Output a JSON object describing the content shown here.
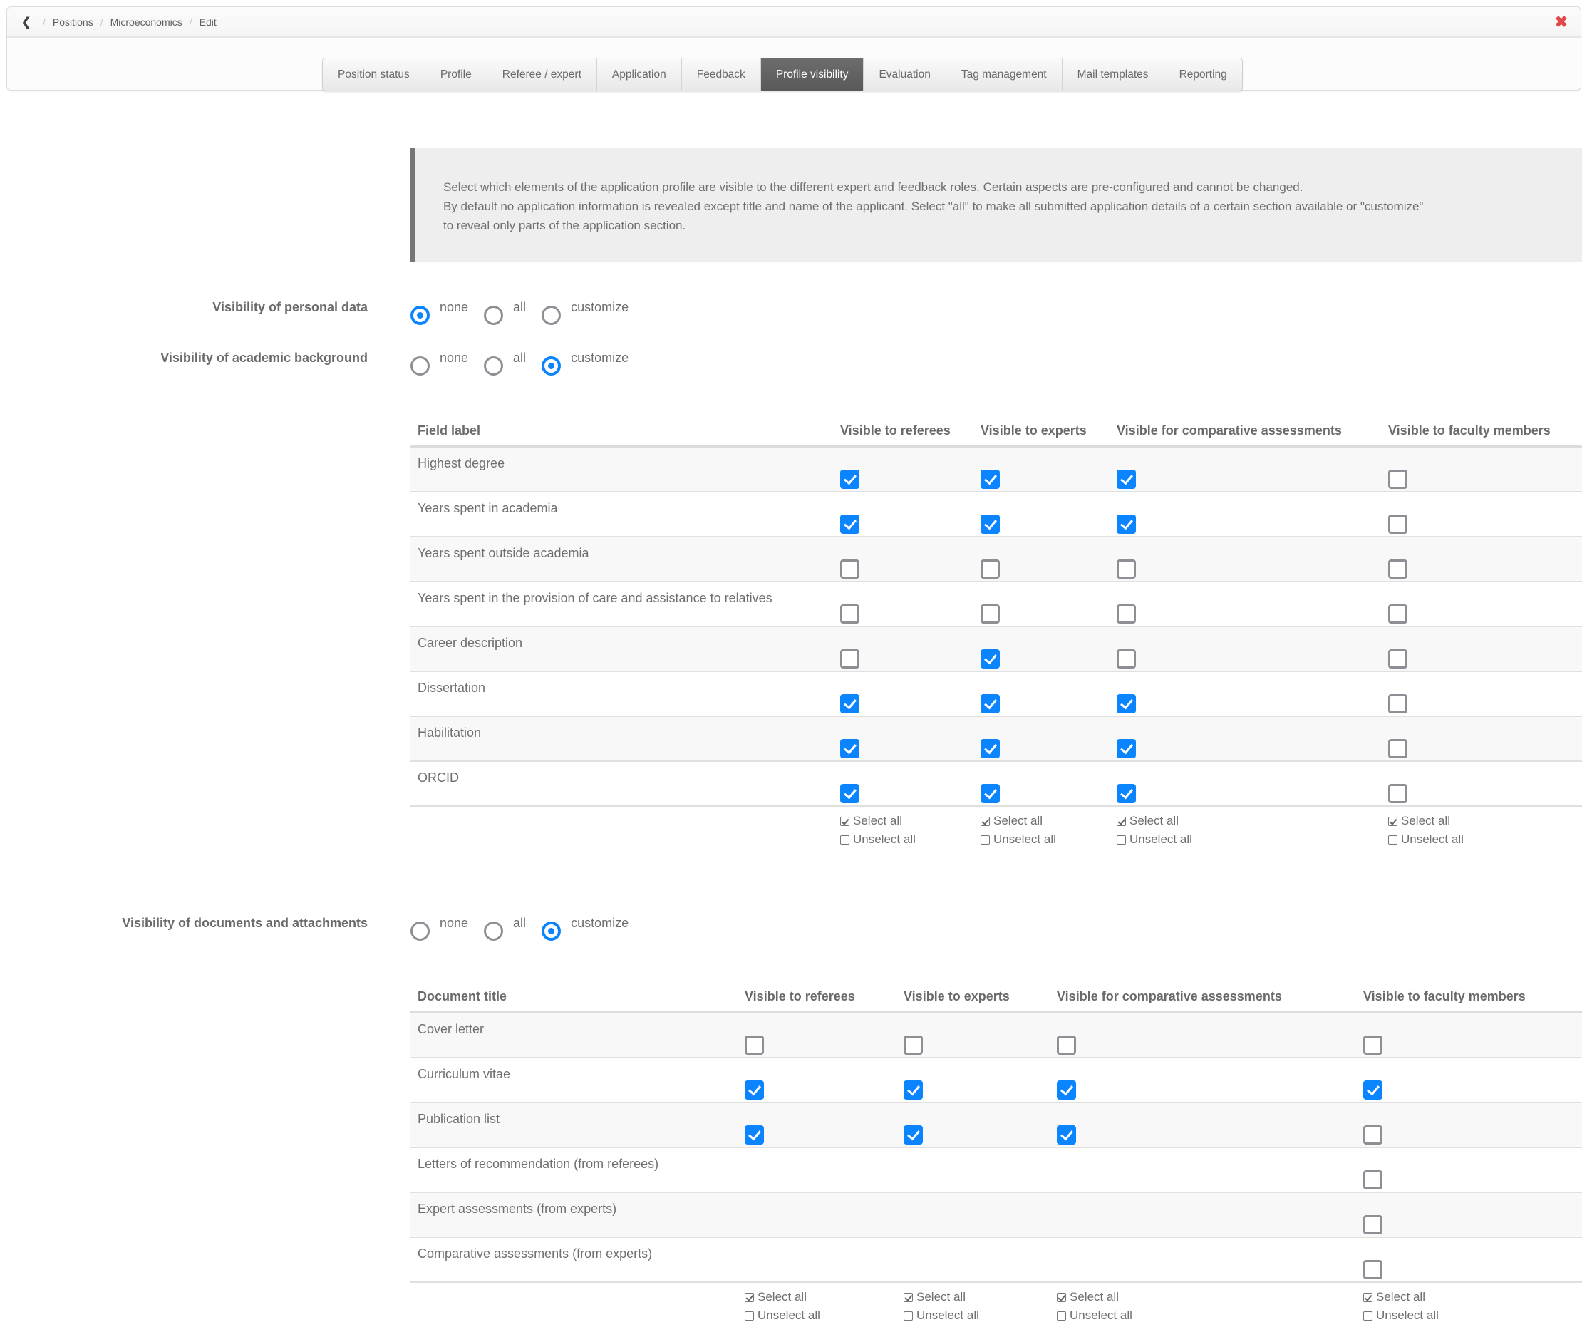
{
  "breadcrumb": {
    "back_icon": "chevron-left-icon",
    "items": [
      "Positions",
      "Microeconomics",
      "Edit"
    ],
    "close_icon": "close-x-icon",
    "close_color": "#e0484a"
  },
  "tabs": [
    {
      "label": "Position status",
      "active": false
    },
    {
      "label": "Profile",
      "active": false
    },
    {
      "label": "Referee / expert",
      "active": false
    },
    {
      "label": "Application",
      "active": false
    },
    {
      "label": "Feedback",
      "active": false
    },
    {
      "label": "Profile visibility",
      "active": true
    },
    {
      "label": "Evaluation",
      "active": false
    },
    {
      "label": "Tag management",
      "active": false
    },
    {
      "label": "Mail templates",
      "active": false
    },
    {
      "label": "Reporting",
      "active": false
    }
  ],
  "info": {
    "line1": "Select which elements of the application profile are visible to the different expert and feedback roles. Certain aspects are pre-configured and cannot be changed.",
    "line2": "By default no application information is revealed except title and name of the applicant. Select \"all\" to make all submitted application details of a certain section available or \"customize\"",
    "line3": "to reveal only parts of the application section."
  },
  "accent_color": "#0a84ff",
  "radio_options": [
    "none",
    "all",
    "customize"
  ],
  "visibility_groups": {
    "personal": {
      "label": "Visibility of personal data",
      "selected": "none"
    },
    "academic": {
      "label": "Visibility of academic background",
      "selected": "customize"
    },
    "documents": {
      "label": "Visibility of documents and attachments",
      "selected": "customize"
    }
  },
  "academic_table": {
    "columns": [
      "Field label",
      "Visible to referees",
      "Visible to experts",
      "Visible for comparative assessments",
      "Visible to faculty members"
    ],
    "rows": [
      {
        "label": "Highest degree",
        "values": [
          true,
          true,
          true,
          false
        ]
      },
      {
        "label": "Years spent in academia",
        "values": [
          true,
          true,
          true,
          false
        ]
      },
      {
        "label": "Years spent outside academia",
        "values": [
          false,
          false,
          false,
          false
        ]
      },
      {
        "label": "Years spent in the provision of care and assistance to relatives",
        "values": [
          false,
          false,
          false,
          false
        ]
      },
      {
        "label": "Career description",
        "values": [
          false,
          true,
          false,
          false
        ]
      },
      {
        "label": "Dissertation",
        "values": [
          true,
          true,
          true,
          false
        ]
      },
      {
        "label": "Habilitation",
        "values": [
          true,
          true,
          true,
          false
        ]
      },
      {
        "label": "ORCID",
        "values": [
          true,
          true,
          true,
          false
        ]
      }
    ],
    "select_all": "Select all",
    "unselect_all": "Unselect all"
  },
  "documents_table": {
    "columns": [
      "Document title",
      "Visible to referees",
      "Visible to experts",
      "Visible for comparative assessments",
      "Visible to faculty members"
    ],
    "rows": [
      {
        "label": "Cover letter",
        "values": [
          false,
          false,
          false,
          false
        ]
      },
      {
        "label": "Curriculum vitae",
        "values": [
          true,
          true,
          true,
          true
        ]
      },
      {
        "label": "Publication list",
        "values": [
          true,
          true,
          true,
          false
        ]
      },
      {
        "label": "Letters of recommendation (from referees)",
        "values": [
          null,
          null,
          null,
          false
        ]
      },
      {
        "label": "Expert assessments (from experts)",
        "values": [
          null,
          null,
          null,
          false
        ]
      },
      {
        "label": "Comparative assessments (from experts)",
        "values": [
          null,
          null,
          null,
          false
        ]
      }
    ],
    "select_all": "Select all",
    "unselect_all": "Unselect all"
  }
}
